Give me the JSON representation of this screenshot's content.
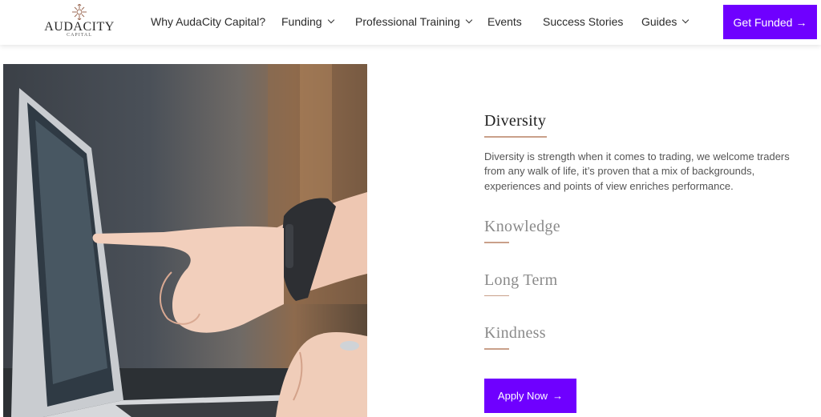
{
  "brand": {
    "name": "AUDACITY",
    "tagline": "CAPITAL"
  },
  "nav": {
    "items": [
      {
        "label": "Why AudaCity Capital?",
        "has_dropdown": false
      },
      {
        "label": "Funding",
        "has_dropdown": true
      },
      {
        "label": "Professional Training",
        "has_dropdown": true
      },
      {
        "label": "Events",
        "has_dropdown": false
      },
      {
        "label": "Success Stories",
        "has_dropdown": false
      },
      {
        "label": "Guides",
        "has_dropdown": true
      }
    ],
    "cta_label": "Get Funded",
    "cta_arrow": "→"
  },
  "values": {
    "active": {
      "title": "Diversity",
      "description": "Diversity is strength when it comes to trading, we welcome traders from any walk of life, it’s proven that a mix of backgrounds, experiences and points of view enriches performance."
    },
    "others": [
      "Knowledge",
      "Long Term",
      "Kindness"
    ]
  },
  "apply": {
    "label": "Apply Now",
    "arrow": "→"
  },
  "colors": {
    "accent": "#6f00ff",
    "underline": "#c9a08a"
  }
}
